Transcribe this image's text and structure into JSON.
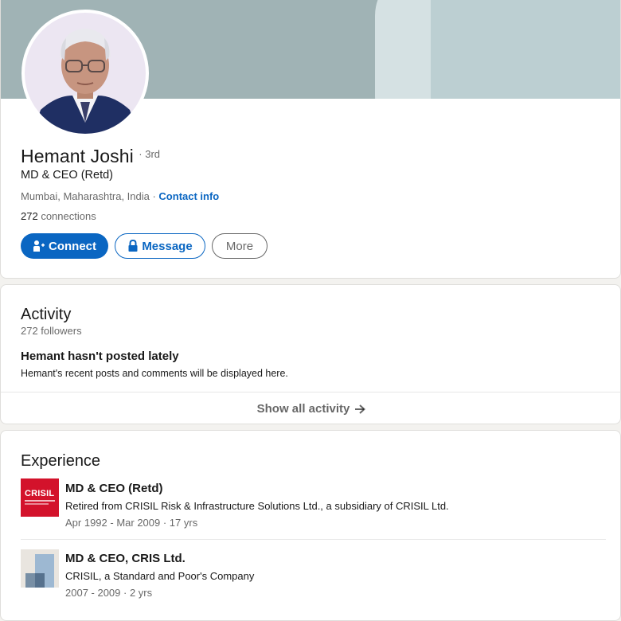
{
  "profile": {
    "name": "Hemant Joshi",
    "degree": "· 3rd",
    "headline": "MD & CEO (Retd)",
    "location": "Mumbai, Maharashtra, India",
    "location_separator": " · ",
    "contact_info_label": "Contact info",
    "connections_count": "272",
    "connections_label": " connections",
    "buttons": {
      "connect": "Connect",
      "message": "Message",
      "more": "More"
    },
    "colors": {
      "brand_blue": "#0a66c2",
      "banner": "#a0b3b5"
    }
  },
  "activity": {
    "title": "Activity",
    "followers": "272 followers",
    "empty_title": "Hemant hasn't posted lately",
    "empty_subtitle": "Hemant's recent posts and comments will be displayed here.",
    "show_all_label": "Show all activity",
    "show_all_icon": "arrow-right-icon"
  },
  "experience": {
    "title": "Experience",
    "items": [
      {
        "title": "MD & CEO (Retd)",
        "subtitle": "Retired from CRISIL Risk & Infrastructure Solutions Ltd., a subsidiary of CRISIL Ltd.",
        "dates": "Apr 1992 - Mar 2009 · 17 yrs",
        "logo_text": "CRISIL",
        "logo_color": "#d3122b"
      },
      {
        "title": "MD & CEO, CRIS Ltd.",
        "subtitle": "CRISIL, a Standard and Poor's Company",
        "dates": "2007 - 2009 · 2 yrs",
        "logo_icon": "company-placeholder-icon"
      }
    ]
  }
}
